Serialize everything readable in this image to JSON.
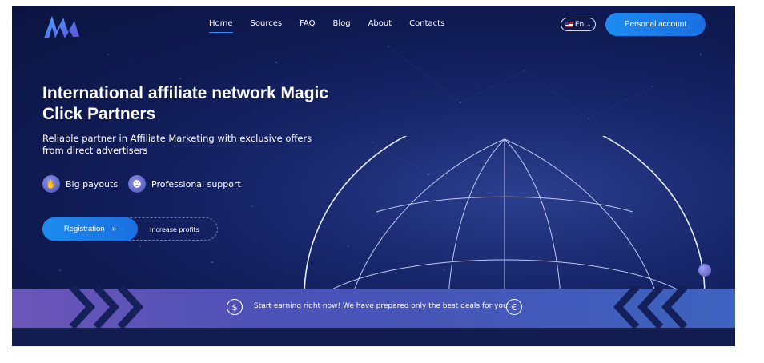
{
  "header": {
    "logo_icon": "m-wave-logo",
    "nav": [
      {
        "label": "Home",
        "active": true
      },
      {
        "label": "Sources"
      },
      {
        "label": "FAQ"
      },
      {
        "label": "Blog"
      },
      {
        "label": "About"
      },
      {
        "label": "Contacts"
      }
    ],
    "language": {
      "flag_icon": "us-flag-icon",
      "label": "En"
    },
    "account_button": "Personal account"
  },
  "hero": {
    "title": "International affiliate network Magic Click Partners",
    "subtitle": "Reliable partner in Affiliate Marketing with exclusive offers from direct advertisers",
    "features": [
      {
        "icon": "hand-coin-icon",
        "label": "Big payouts"
      },
      {
        "icon": "support-agent-icon",
        "label": "Professional support"
      }
    ],
    "registration_button": "Registration",
    "registration_icon": "double-chevron-right-icon",
    "increase_label": "Increase profits"
  },
  "banner": {
    "text": "Start earning right now! We have prepared only the best deals for you",
    "left_icon": "dollar-circle-icon",
    "right_icon": "euro-circle-icon"
  },
  "colors": {
    "accent": "#1d8cf0",
    "background": "#0f1a52",
    "banner": "#5a55b8"
  }
}
